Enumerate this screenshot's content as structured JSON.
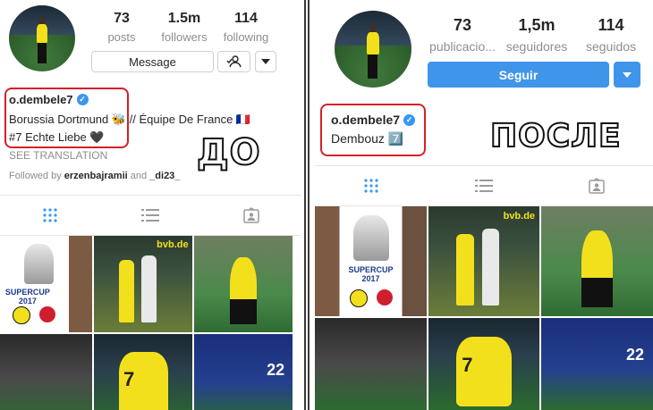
{
  "left": {
    "stats": [
      {
        "value": "73",
        "label": "posts"
      },
      {
        "value": "1.5m",
        "label": "followers"
      },
      {
        "value": "114",
        "label": "following"
      }
    ],
    "message_label": "Message",
    "username": "o.dembele7",
    "bio_line1": "Borussia Dortmund 🐝 // Équipe De France 🇫🇷",
    "bio_line2": "#7 Echte Liebe 🖤",
    "see_translation": "SEE TRANSLATION",
    "followed_by_prefix": "Followed by",
    "followed_by_user": "erzenbajramii",
    "followed_by_and": "and",
    "followed_by_user2": "_di23_",
    "caption": "ДО"
  },
  "right": {
    "stats": [
      {
        "value": "73",
        "label": "publicacio..."
      },
      {
        "value": "1,5m",
        "label": "seguidores"
      },
      {
        "value": "114",
        "label": "seguidos"
      }
    ],
    "follow_label": "Seguir",
    "username": "o.dembele7",
    "bio_line1": "Dembouz 7️⃣",
    "caption": "ПОСЛЕ"
  },
  "tiles": {
    "supercup_title": "SUPERCUP",
    "supercup_year": "2017",
    "bvb_sign": "bvb.de",
    "jersey_number": "7",
    "france_number": "22"
  },
  "colors": {
    "accent_blue": "#3f95ea",
    "highlight_red": "#d4202a",
    "verified_blue": "#3897f0",
    "grid_active": "#3897f0",
    "bvb_yellow": "#f3e01c"
  },
  "icons": [
    "verified-badge-icon",
    "add-person-icon",
    "chevron-down-icon",
    "grid-icon",
    "list-icon",
    "tagged-icon"
  ]
}
